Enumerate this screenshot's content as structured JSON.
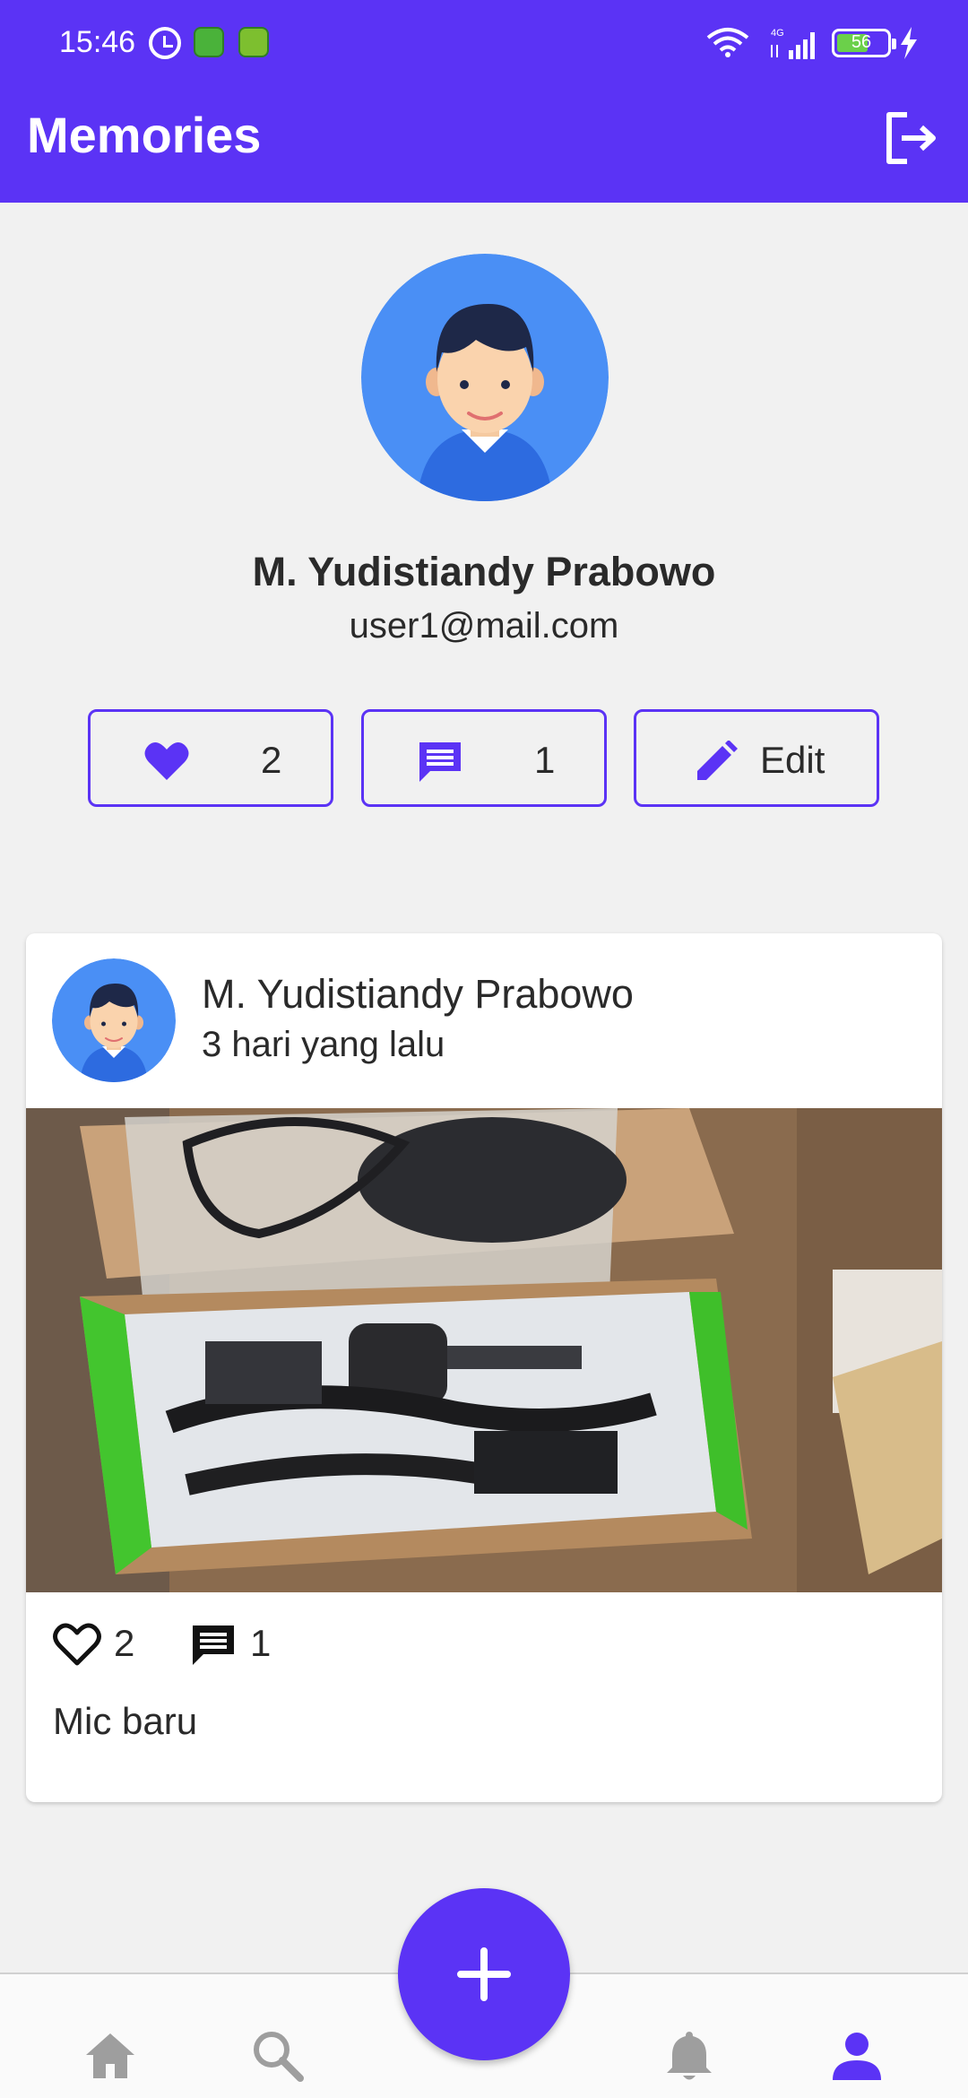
{
  "status_bar": {
    "time": "15:46",
    "network": "4G",
    "battery": "56"
  },
  "app_bar": {
    "title": "Memories",
    "logout_icon": "logout-icon"
  },
  "profile": {
    "name": "M. Yudistiandy Prabowo",
    "email": "user1@mail.com",
    "likes_count": "2",
    "comments_count": "1",
    "edit_label": "Edit"
  },
  "post": {
    "author": "M. Yudistiandy Prabowo",
    "time_ago": "3 hari yang lalu",
    "likes": "2",
    "comments": "1",
    "caption": "Mic baru"
  },
  "bottom_nav": {
    "items": [
      "home-icon",
      "search-icon",
      "add-icon",
      "bell-icon",
      "profile-icon"
    ],
    "active": "profile-icon"
  },
  "colors": {
    "primary": "#5b33f5",
    "background": "#f1f1f1",
    "nav_inactive": "#9e9e9e"
  }
}
